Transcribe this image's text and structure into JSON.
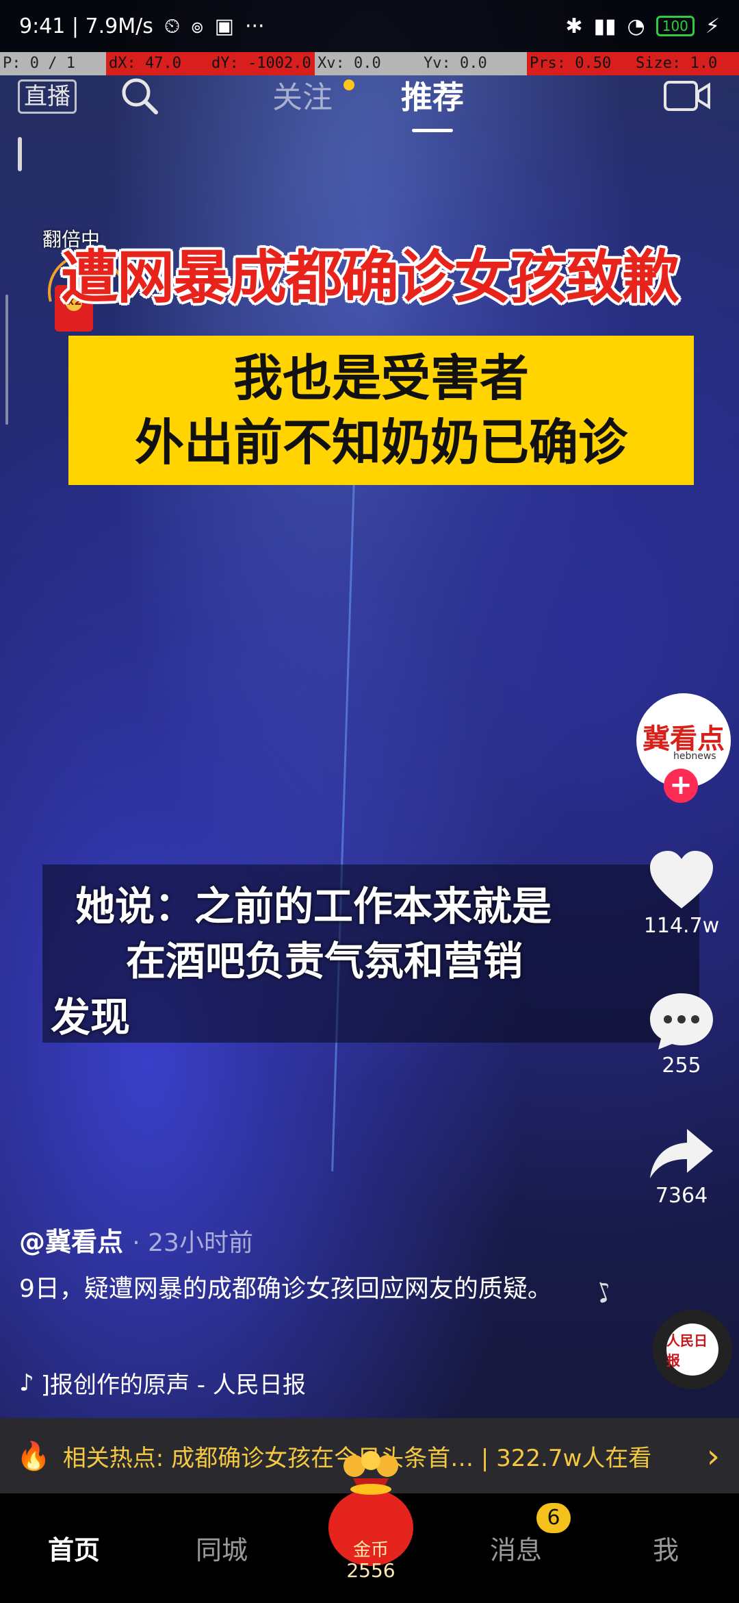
{
  "status_bar": {
    "time_speed": "9:41 | 7.9M/s",
    "dots": "···",
    "battery": "100"
  },
  "debug": {
    "p": "P: 0 / 1",
    "dx": "dX: 47.0",
    "dy": "dY: -1002.0",
    "xv": "Xv: 0.0",
    "yv": "Yv: 0.0",
    "prs": "Prs: 0.50",
    "size": "Size: 1.0"
  },
  "top_nav": {
    "live": "直播",
    "follow": "关注",
    "recommend": "推荐"
  },
  "envelope": {
    "label": "翻倍中",
    "multiplier": "x2"
  },
  "video": {
    "headline": "遭网暴成都确诊女孩致歉",
    "box_line1": "我也是受害者",
    "box_line2": "外出前不知奶奶已确诊",
    "caption_line1": "她说：之前的工作本来就是",
    "caption_line2": "在酒吧负责气氛和营销",
    "caption_line3": "发现"
  },
  "actions": {
    "avatar_text": "冀看点",
    "avatar_sub": "hebnews",
    "likes": "114.7w",
    "comments": "255",
    "shares": "7364"
  },
  "post": {
    "author": "@冀看点",
    "time_ago": "· 23小时前",
    "description": "9日，疑遭网暴的成都确诊女孩回应网友的质疑。",
    "music": "]报创作的原声 - 人民日报",
    "disc_label": "人民日报"
  },
  "hot_topic": {
    "text": "相关热点: 成都确诊女孩在今日头条首… | 322.7w人在看"
  },
  "bottom_nav": {
    "home": "首页",
    "city": "同城",
    "coin_label": "金币",
    "coin_count": "2556",
    "messages": "消息",
    "messages_badge": "6",
    "me": "我"
  }
}
